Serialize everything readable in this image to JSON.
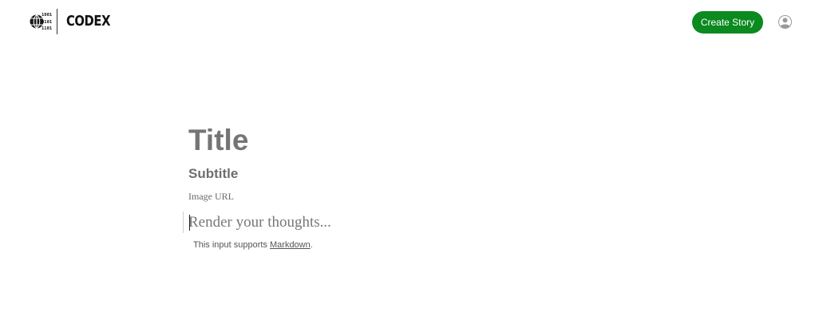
{
  "header": {
    "logo_text": "CODEX",
    "logo_mark_rows": [
      "1001",
      "0101",
      "1101"
    ],
    "create_button_label": "Create Story",
    "accent_color": "#0a8a1f",
    "avatar_icon": "user-avatar-icon"
  },
  "editor": {
    "title_placeholder": "Title",
    "subtitle_placeholder": "Subtitle",
    "image_url_placeholder": "Image URL",
    "body_placeholder": "Render your thoughts...",
    "hint_prefix": "This input supports ",
    "hint_link": "Markdown",
    "hint_suffix": "."
  }
}
